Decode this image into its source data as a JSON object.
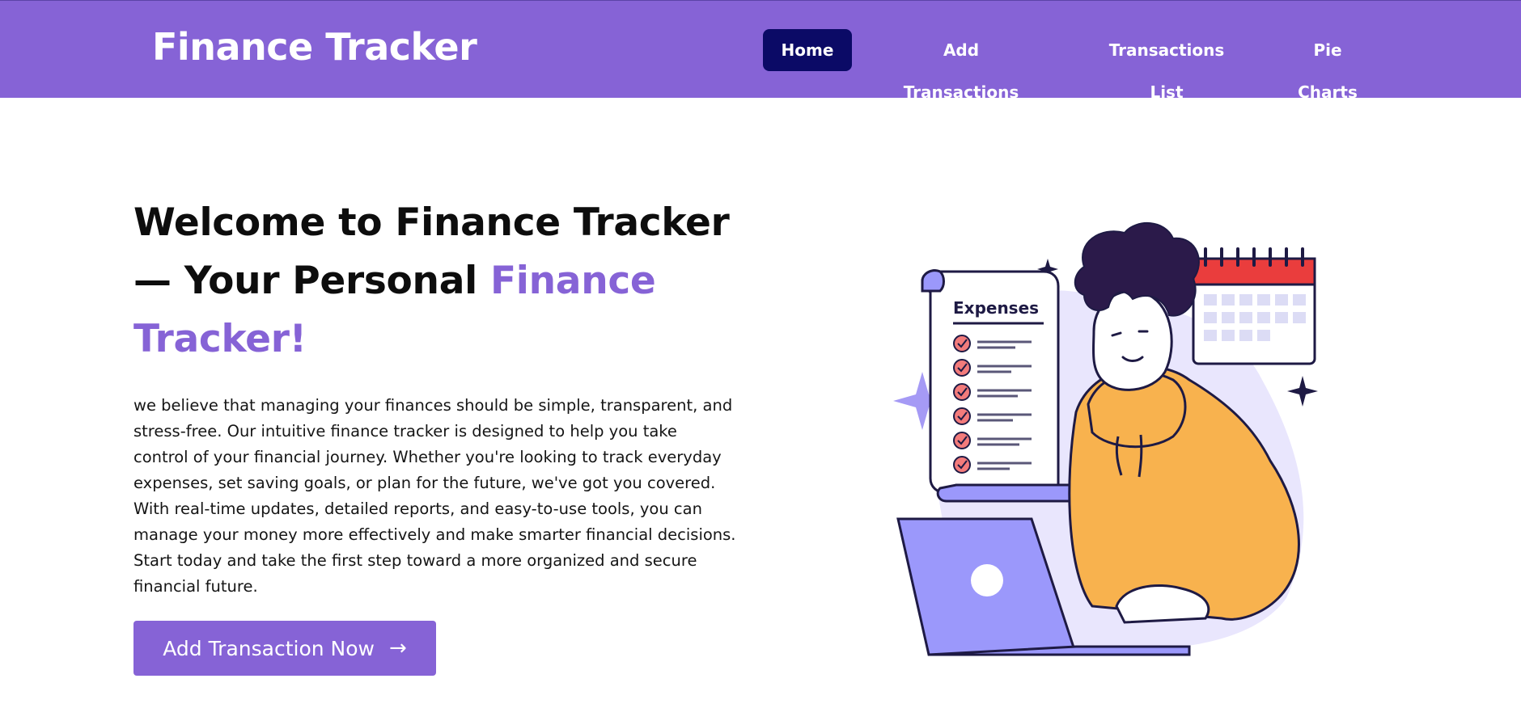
{
  "header": {
    "brand": "Finance Tracker",
    "nav": [
      {
        "label": "Home",
        "active": true
      },
      {
        "label": "Add Transactions",
        "active": false
      },
      {
        "label": "Transactions List",
        "active": false
      },
      {
        "label": "Pie Charts",
        "active": false
      }
    ]
  },
  "hero": {
    "title_part1": "Welcome to Finance Tracker",
    "title_part2": "— Your Personal ",
    "title_accent1": "Finance",
    "title_accent2": "Tracker!",
    "description": "we believe that managing your finances should be simple, transparent, and stress-free. Our intuitive finance tracker is designed to help you take control of your financial journey. Whether you're looking to track everyday expenses, set saving goals, or plan for the future, we've got you covered. With real-time updates, detailed reports, and easy-to-use tools, you can manage your money more effectively and make smarter financial decisions. Start today and take the first step toward a more organized and secure financial future.",
    "cta_label": "Add Transaction Now",
    "cta_arrow": "→"
  },
  "illustration": {
    "expenses_label": "Expenses",
    "icons": [
      "receipt-icon",
      "calendar-icon",
      "laptop-icon",
      "sparkle-icon"
    ]
  },
  "colors": {
    "brand": "#8663d6",
    "active_nav": "#0b0a66",
    "hoodie": "#f8b24e",
    "laptop": "#9b98fb",
    "calendar_accent": "#ea3d3d"
  }
}
